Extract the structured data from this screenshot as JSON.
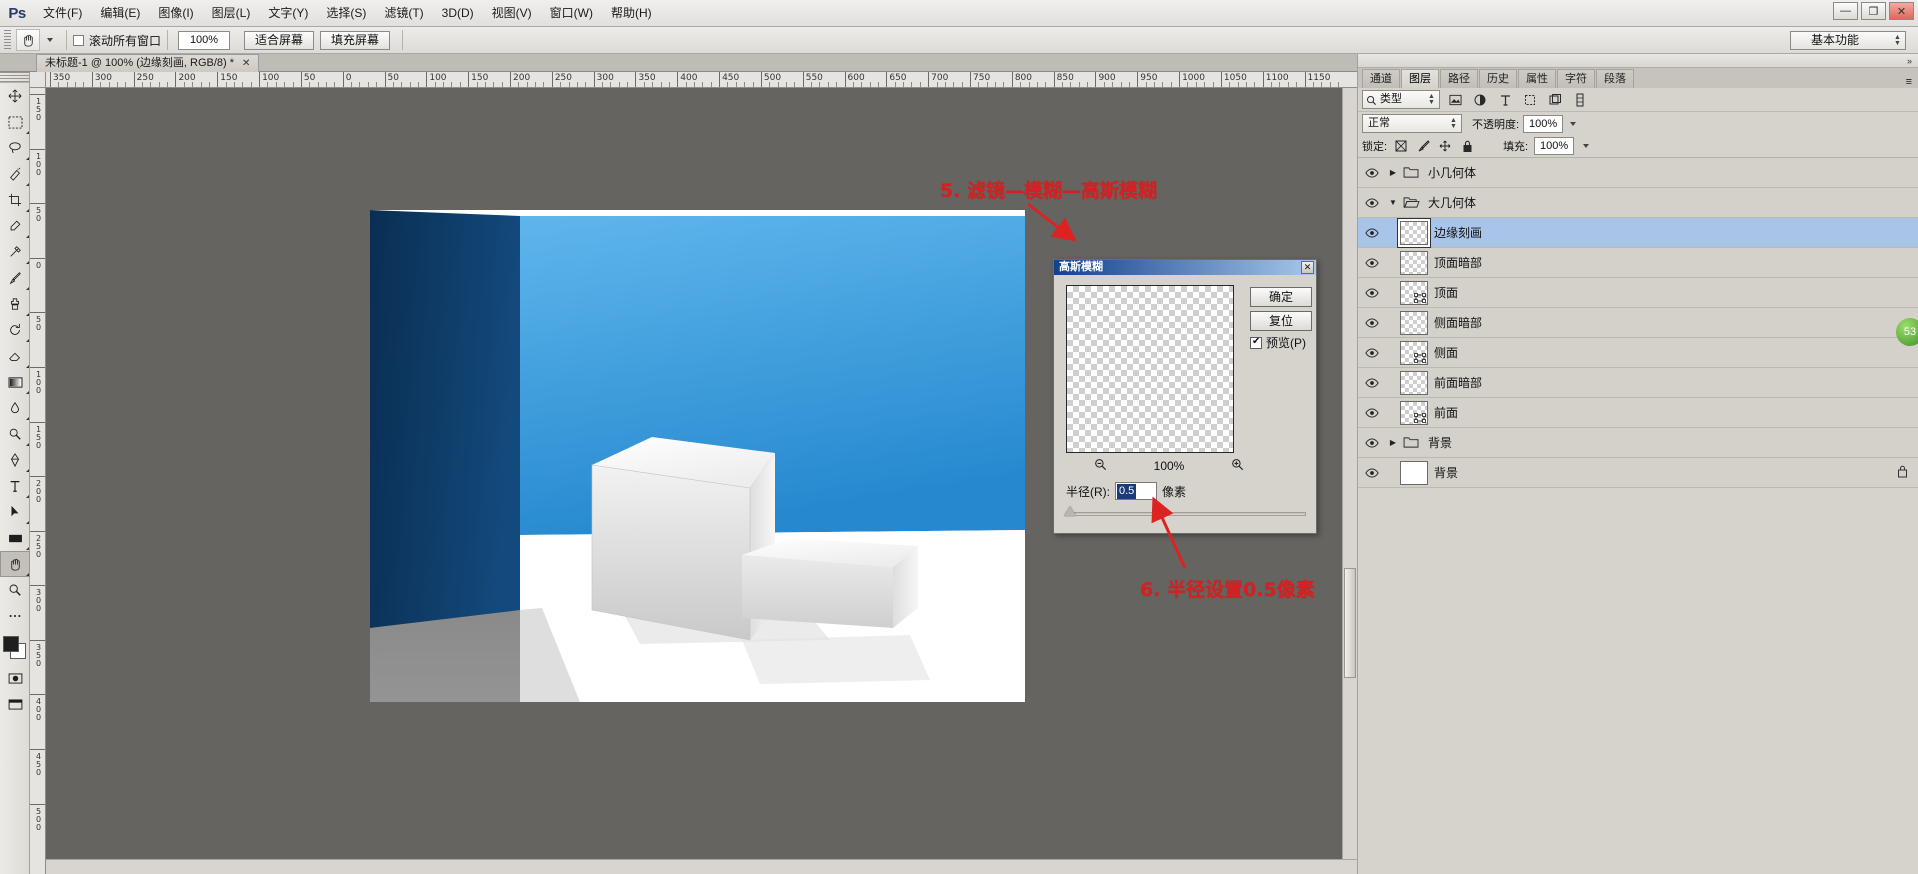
{
  "app": {
    "logo": "Ps",
    "title": "Adobe Photoshop"
  },
  "menubar": {
    "items": [
      {
        "label": "文件(F)"
      },
      {
        "label": "编辑(E)"
      },
      {
        "label": "图像(I)"
      },
      {
        "label": "图层(L)"
      },
      {
        "label": "文字(Y)"
      },
      {
        "label": "选择(S)"
      },
      {
        "label": "滤镜(T)"
      },
      {
        "label": "3D(D)"
      },
      {
        "label": "视图(V)"
      },
      {
        "label": "窗口(W)"
      },
      {
        "label": "帮助(H)"
      }
    ],
    "window_buttons": {
      "minimize": "—",
      "maximize": "❐",
      "close": "✕"
    }
  },
  "optionsbar": {
    "tool_icon": "hand-tool",
    "scroll_all_windows_label": "滚动所有窗口",
    "zoom_value": "100%",
    "fit_screen_label": "适合屏幕",
    "fill_screen_label": "填充屏幕",
    "workspace_label": "基本功能"
  },
  "document": {
    "tab_label": "未标题-1 @ 100% (边缘刻画, RGB/8) *",
    "close_glyph": "✕"
  },
  "rulers": {
    "h_labels": [
      "350",
      "300",
      "250",
      "200",
      "150",
      "100",
      "50",
      "0",
      "50",
      "100",
      "150",
      "200",
      "250",
      "300",
      "350",
      "400",
      "450",
      "500",
      "550",
      "600",
      "650",
      "700",
      "750",
      "800",
      "850",
      "900",
      "950",
      "1000",
      "1050",
      "1100",
      "1150"
    ],
    "v_labels": [
      "150",
      "100",
      "50",
      "0",
      "50",
      "100",
      "150",
      "200",
      "250",
      "300",
      "350",
      "400",
      "450",
      "500"
    ]
  },
  "toolbar": {
    "tools": [
      {
        "name": "move-tool",
        "glyph": "✥"
      },
      {
        "name": "marquee-tool",
        "glyph": "▭"
      },
      {
        "name": "lasso-tool",
        "glyph": "◌"
      },
      {
        "name": "quick-selection-tool",
        "glyph": "✎"
      },
      {
        "name": "crop-tool",
        "glyph": "⌗"
      },
      {
        "name": "eyedropper-tool",
        "glyph": "⚲"
      },
      {
        "name": "healing-brush-tool",
        "glyph": "✚"
      },
      {
        "name": "brush-tool",
        "glyph": "🖌"
      },
      {
        "name": "clone-stamp-tool",
        "glyph": "⎙"
      },
      {
        "name": "history-brush-tool",
        "glyph": "↺"
      },
      {
        "name": "eraser-tool",
        "glyph": "◧"
      },
      {
        "name": "gradient-tool",
        "glyph": "▤"
      },
      {
        "name": "blur-tool",
        "glyph": "◐"
      },
      {
        "name": "dodge-tool",
        "glyph": "☉"
      },
      {
        "name": "pen-tool",
        "glyph": "✒"
      },
      {
        "name": "type-tool",
        "glyph": "T"
      },
      {
        "name": "path-selection-tool",
        "glyph": "➤"
      },
      {
        "name": "shape-tool",
        "glyph": "▬"
      },
      {
        "name": "hand-tool",
        "glyph": "✋"
      },
      {
        "name": "zoom-tool",
        "glyph": "🔍"
      },
      {
        "name": "more-tools",
        "glyph": "⋯"
      }
    ],
    "foreground_color": "#1f1f1f",
    "background_color": "#ffffff",
    "quick-mask": "◳",
    "screen-mode": "▣"
  },
  "panels": {
    "tabs": [
      {
        "label": "通道",
        "active": false
      },
      {
        "label": "图层",
        "active": true
      },
      {
        "label": "路径",
        "active": false
      },
      {
        "label": "历史",
        "active": false
      },
      {
        "label": "属性",
        "active": false
      },
      {
        "label": "字符",
        "active": false
      },
      {
        "label": "段落",
        "active": false
      }
    ],
    "menu_glyph": "≡",
    "filter_type_label": "类型",
    "filter_icons": [
      "pixel-filter-icon",
      "adjustment-filter-icon",
      "type-filter-icon",
      "shape-filter-icon",
      "smartobject-filter-icon",
      "toggle-filter-icon"
    ],
    "blend_mode": "正常",
    "opacity_label": "不透明度:",
    "opacity_value": "100%",
    "lock_label": "锁定:",
    "lock_icons": [
      "lock-transparency-icon",
      "lock-image-icon",
      "lock-position-icon",
      "lock-all-icon"
    ],
    "fill_label": "填充:",
    "fill_value": "100%",
    "layers": [
      {
        "name": "小几何体",
        "type": "group",
        "expanded": false,
        "selected": false,
        "visible": true,
        "locked": false
      },
      {
        "name": "大几何体",
        "type": "group",
        "expanded": true,
        "selected": false,
        "visible": true,
        "locked": false
      },
      {
        "name": "边缘刻画",
        "type": "layer",
        "selected": true,
        "visible": true,
        "locked": false,
        "thumb": "transparent"
      },
      {
        "name": "顶面暗部",
        "type": "layer",
        "selected": false,
        "visible": true,
        "locked": false,
        "thumb": "transparent"
      },
      {
        "name": "顶面",
        "type": "layer",
        "selected": false,
        "visible": true,
        "locked": false,
        "thumb": "vector"
      },
      {
        "name": "侧面暗部",
        "type": "layer",
        "selected": false,
        "visible": true,
        "locked": false,
        "thumb": "transparent"
      },
      {
        "name": "侧面",
        "type": "layer",
        "selected": false,
        "visible": true,
        "locked": false,
        "thumb": "vector"
      },
      {
        "name": "前面暗部",
        "type": "layer",
        "selected": false,
        "visible": true,
        "locked": false,
        "thumb": "transparent"
      },
      {
        "name": "前面",
        "type": "layer",
        "selected": false,
        "visible": true,
        "locked": false,
        "thumb": "vector"
      },
      {
        "name": "背景",
        "type": "group",
        "expanded": false,
        "selected": false,
        "visible": true,
        "locked": false
      },
      {
        "name": "背景",
        "type": "layer",
        "selected": false,
        "visible": true,
        "locked": true,
        "thumb": "white"
      }
    ],
    "eye_glyph": "👁",
    "lock_badge_glyph": "🔒"
  },
  "dialog": {
    "title": "高斯模糊",
    "close_glyph": "✕",
    "ok_label": "确定",
    "reset_label": "复位",
    "preview_label": "预览(P)",
    "zoom_out_glyph": "⊖",
    "zoom_value": "100%",
    "zoom_in_glyph": "⊕",
    "radius_label": "半径(R):",
    "radius_value": "0.5",
    "radius_unit": "像素"
  },
  "annotations": [
    {
      "name": "annotation-step-5",
      "text": "5. 滤镜—模糊—高斯模糊"
    },
    {
      "name": "annotation-step-6",
      "text": "6. 半径设置0.5像素"
    }
  ],
  "badge": {
    "text": "53"
  },
  "colors": {
    "wall_light": "#3d9fe0",
    "wall_dark": "#0d3a63",
    "floor_white": "#ffffff",
    "floor_gray": "#8d8d8d",
    "accent_red": "#d32020",
    "selection_blue": "#a8c4e8"
  }
}
